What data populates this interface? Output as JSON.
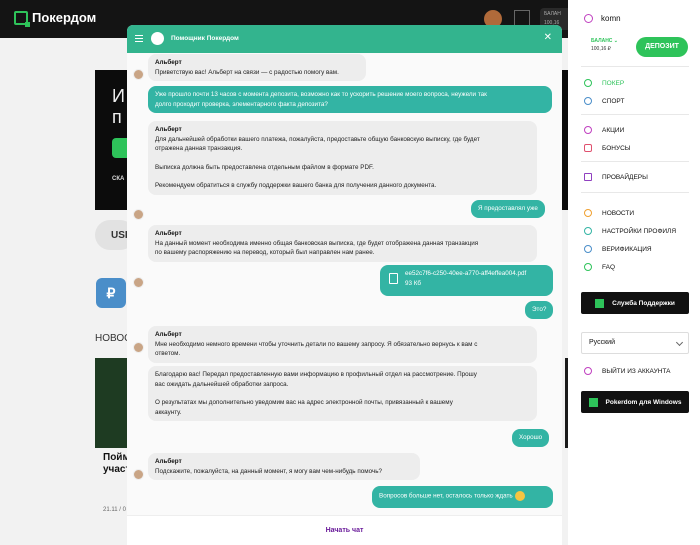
{
  "brand": {
    "name": "Покердом",
    "accent": "#2ec35a",
    "chat_accent": "#33b48e"
  },
  "topbar": {
    "balance_label": "БАЛАН",
    "balance_value": "100,16"
  },
  "background": {
    "banner_title": "И",
    "banner_title2": "п",
    "banner_sub": "СКА",
    "pill": "USI",
    "news_heading": "НОВОС",
    "news_text1": "Пойм",
    "news_text2": "участ",
    "news_date": "21.11 / 0"
  },
  "sidebar": {
    "username": "komn",
    "balance_label": "БАЛАНС",
    "balance_value": "100,16 ₽",
    "deposit": "ДЕПОЗИТ",
    "items1": [
      {
        "label": "ПОКЕР",
        "icon": "spade-icon"
      },
      {
        "label": "СПОРТ",
        "icon": "ball-icon"
      }
    ],
    "items2": [
      {
        "label": "АКЦИИ",
        "icon": "star-icon"
      },
      {
        "label": "БОНУСЫ",
        "icon": "gift-icon"
      }
    ],
    "items3": [
      {
        "label": "ПРОВАЙДЕРЫ",
        "icon": "grid-icon"
      }
    ],
    "items4": [
      {
        "label": "НОВОСТИ",
        "icon": "bulb-icon"
      },
      {
        "label": "НАСТРОЙКИ ПРОФИЛЯ",
        "icon": "gear-icon"
      },
      {
        "label": "ВЕРИФИКАЦИЯ",
        "icon": "check-icon"
      },
      {
        "label": "FAQ",
        "icon": "chat-icon"
      }
    ],
    "support": "Служба Поддержки",
    "language": "Русский",
    "logout": "ВЫЙТИ ИЗ АККАУНТА",
    "windows": "Pokerdom для Windows"
  },
  "chat": {
    "title": "Помощник Покердом",
    "footer": "Начать чат",
    "messages": {
      "m1_name": "Альберт",
      "m1_text": "Приветствую вас! Альберт на связи — с радостью помогу вам.",
      "m2_text1": "Уже прошло почти 13 часов с момента депозита, возможно как то ускорить решение моего вопроса, неужели так",
      "m2_text2": "долго проходит проверка, элементарного факта депозита?",
      "m3_name": "Альберт",
      "m3_l1": "Для дальнейшей обработки вашего платежа, пожалуйста, предоставьте общую банковскую выписку, где будет",
      "m3_l2": "отражена данная транзакция.",
      "m3_l3": "Выписка должна быть предоставлена отдельным файлом в формате PDF.",
      "m3_l4": "Рекомендуем обратиться в службу поддержки вашего банка для получения данного документа.",
      "m4_text": "Я предоставлял уже",
      "m5_name": "Альберт",
      "m5_l1": "На данный момент необходима именно общая банковская выписка, где будет отображена данная транзакция",
      "m5_l2": "по вашему распоряжению на перевод, который был направлен нам ранее.",
      "m6_file": "ee52c7f6-c250-40ee-a770-aff4effea004.pdf",
      "m6_size": "93 Кб",
      "m7_text": "Это?",
      "m8_name": "Альберт",
      "m8_l1": "Мне необходимо немного времени чтобы уточнить детали по вашему запросу. Я обязательно вернусь к вам с",
      "m8_l2": "ответом.",
      "m9_l1": "Благодарю вас! Передал предоставленную вами информацию в профильный отдел на рассмотрение. Прошу",
      "m9_l2": "вас ожидать дальнейшей обработки запроса.",
      "m9_l3": "О результатах мы дополнительно уведомим вас на адрес электронной почты, привязанный к вашему",
      "m9_l4": "аккаунту.",
      "m10_text": "Хорошо",
      "m11_name": "Альберт",
      "m11_text": "Подскажите, пожалуйста, на данный момент, я могу вам чем-нибудь помочь?",
      "m12_text": "Вопросов больше нет, осталось только ждать"
    }
  }
}
